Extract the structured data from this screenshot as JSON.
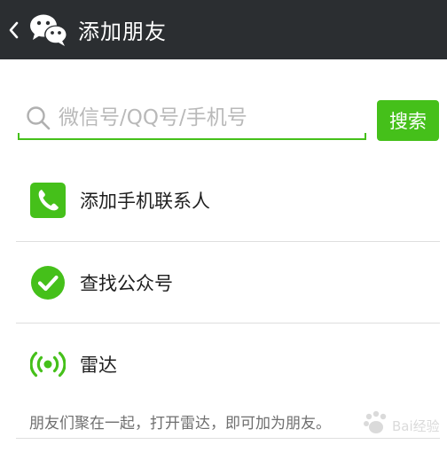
{
  "header": {
    "title": "添加朋友",
    "back_icon": "chevron-left-icon",
    "logo_icon": "wechat-logo-icon",
    "background": "#2b2e31"
  },
  "search": {
    "placeholder": "微信号/QQ号/手机号",
    "value": "",
    "button_label": "搜索",
    "icon": "search-icon",
    "accent": "#45c01a"
  },
  "menu": {
    "items": [
      {
        "label": "添加手机联系人",
        "icon": "phone-icon"
      },
      {
        "label": "查找公众号",
        "icon": "checkmark-circle-icon"
      },
      {
        "label": "雷达",
        "icon": "radar-icon"
      }
    ]
  },
  "radar_hint": "朋友们聚在一起，打开雷达，即可加为朋友。",
  "watermark": "Bai经验"
}
